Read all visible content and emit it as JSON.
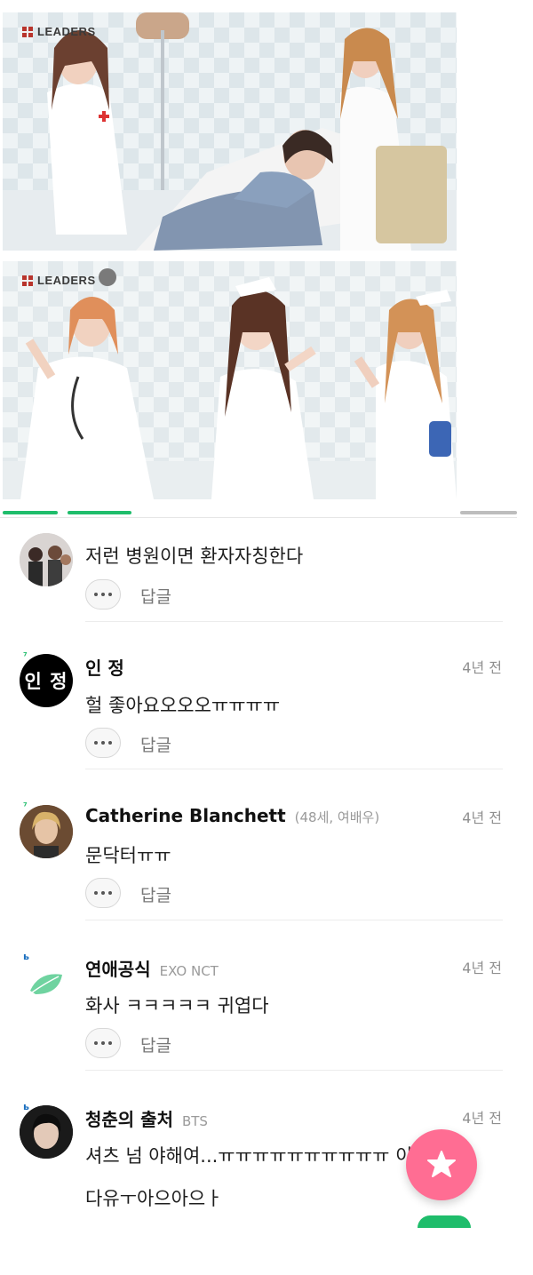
{
  "images": [
    {
      "watermark": "LEADERS"
    },
    {
      "watermark": "LEADERS"
    }
  ],
  "comments": [
    {
      "author": "",
      "sub": "",
      "time": "",
      "text": "저런 병원이면 환자자칭한다",
      "reply_label": "답글",
      "avatar_icon": "group-photo-avatar"
    },
    {
      "author": "인 정",
      "sub": "",
      "time": "4년 전",
      "text": "헐 좋아요오오오ㅠㅠㅠㅠ",
      "reply_label": "답글",
      "avatar_text": "인 정",
      "avatar_icon": "text-avatar"
    },
    {
      "author": "Catherine Blanchett",
      "sub": "(48세, 여배우)",
      "time": "4년 전",
      "text": "문닥터ㅠㅠ",
      "reply_label": "답글",
      "avatar_icon": "portrait-avatar"
    },
    {
      "author": "연애공식",
      "sub": "EXO NCT",
      "time": "4년 전",
      "text": "화사 ㅋㅋㅋㅋㅋ 귀엽다",
      "reply_label": "답글",
      "avatar_icon": "leaf-icon"
    },
    {
      "author": "청춘의 출처",
      "sub": "BTS",
      "time": "4년 전",
      "text": "셔츠 넘 야해여...ㅠㅠㅠㅠㅠㅠㅠㅠㅠㅠ 이쁘",
      "text2": "다유ㅜ아으아으ㅏ",
      "avatar_icon": "portrait-avatar"
    }
  ],
  "fab": {
    "icon": "star-icon",
    "color": "#ff6d93"
  },
  "colors": {
    "accent_green": "#1fbd6b",
    "fab_pink": "#ff6d93"
  }
}
